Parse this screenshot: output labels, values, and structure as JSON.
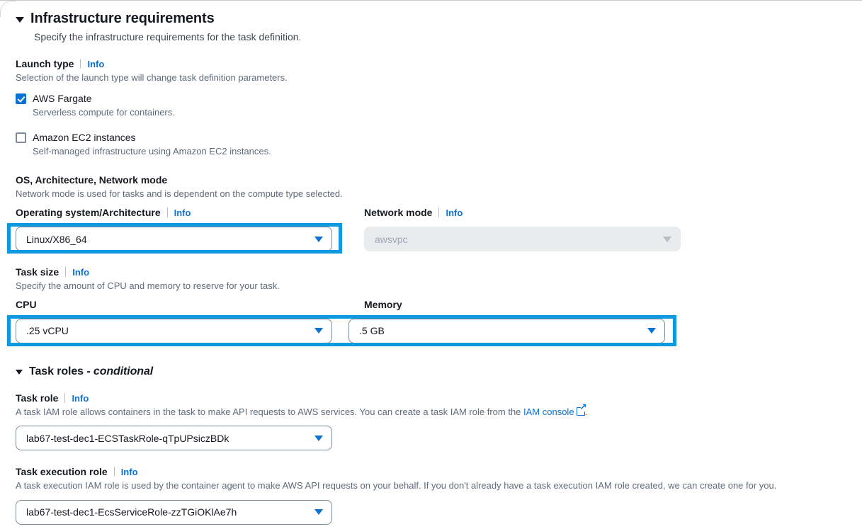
{
  "sections": {
    "infrastructure": {
      "title": "Infrastructure requirements",
      "description": "Specify the infrastructure requirements for the task definition."
    },
    "task_roles": {
      "title_main": "Task roles - ",
      "title_conditional": "conditional"
    }
  },
  "launch_type": {
    "label": "Launch type",
    "info": "Info",
    "help": "Selection of the launch type will change task definition parameters.",
    "options": [
      {
        "label": "AWS Fargate",
        "description": "Serverless compute for containers.",
        "checked": true
      },
      {
        "label": "Amazon EC2 instances",
        "description": "Self-managed infrastructure using Amazon EC2 instances.",
        "checked": false
      }
    ]
  },
  "os_network": {
    "group_label": "OS, Architecture, Network mode",
    "group_help": "Network mode is used for tasks and is dependent on the compute type selected.",
    "os_arch": {
      "label": "Operating system/Architecture",
      "info": "Info",
      "value": "Linux/X86_64"
    },
    "network_mode": {
      "label": "Network mode",
      "info": "Info",
      "value": "awsvpc",
      "disabled": true
    }
  },
  "task_size": {
    "label": "Task size",
    "info": "Info",
    "help": "Specify the amount of CPU and memory to reserve for your task.",
    "cpu": {
      "label": "CPU",
      "value": ".25 vCPU"
    },
    "memory": {
      "label": "Memory",
      "value": ".5 GB"
    }
  },
  "task_role": {
    "label": "Task role",
    "info": "Info",
    "help_before": "A task IAM role allows containers in the task to make API requests to AWS services. You can create a task IAM role from the ",
    "help_link": "IAM console",
    "help_after": ".",
    "value": "lab67-test-dec1-ECSTaskRole-qTpUPsiczBDk"
  },
  "task_execution_role": {
    "label": "Task execution role",
    "info": "Info",
    "help": "A task execution IAM role is used by the container agent to make AWS API requests on your behalf. If you don't already have a task execution IAM role created, we can create one for you.",
    "value": "lab67-test-dec1-EcsServiceRole-zzTGiOKlAe7h"
  },
  "colors": {
    "accent_blue": "#0972d3",
    "highlight_blue": "#0d99e0",
    "text": "#16191f",
    "muted_text": "#5f6b7a",
    "disabled_bg": "#e9ebed"
  }
}
